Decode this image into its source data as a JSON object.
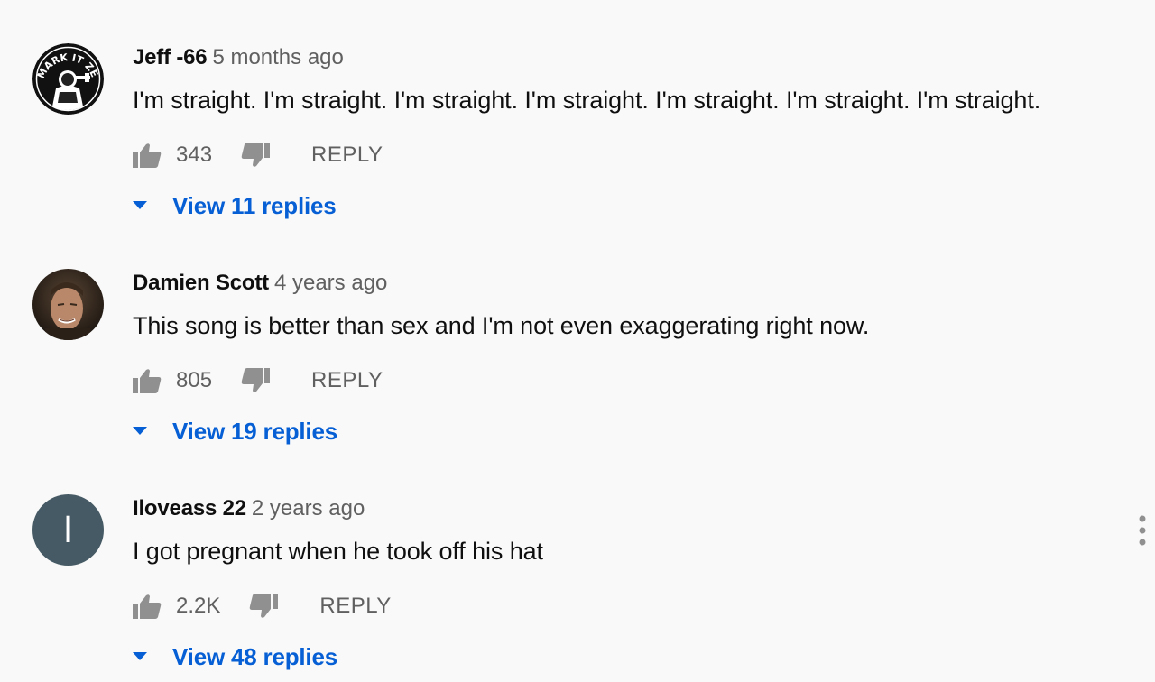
{
  "comments": [
    {
      "author": "Jeff -66",
      "time": "5 months ago",
      "text": "I'm straight. I'm straight. I'm straight. I'm straight. I'm straight. I'm straight. I'm straight.",
      "likes": "343",
      "reply_label": "REPLY",
      "view_replies": "View 11 replies",
      "avatar_text": "MARK IT ZERO"
    },
    {
      "author": "Damien Scott",
      "time": "4 years ago",
      "text": "This song is better than sex and I'm not even exaggerating right now.",
      "likes": "805",
      "reply_label": "REPLY",
      "view_replies": "View 19 replies"
    },
    {
      "author": "Iloveass 22",
      "time": "2 years ago",
      "text": "I got pregnant when he took off his hat",
      "likes": "2.2K",
      "reply_label": "REPLY",
      "view_replies": "View 48 replies",
      "avatar_letter": "I",
      "avatar_color": "#455a64"
    }
  ],
  "colors": {
    "background": "#f9f9f9",
    "link": "#065fd4",
    "secondary_text": "#606060",
    "icon": "#909090"
  },
  "icons": [
    "thumb-up-icon",
    "thumb-down-icon",
    "caret-down-icon",
    "more-vert-icon"
  ]
}
